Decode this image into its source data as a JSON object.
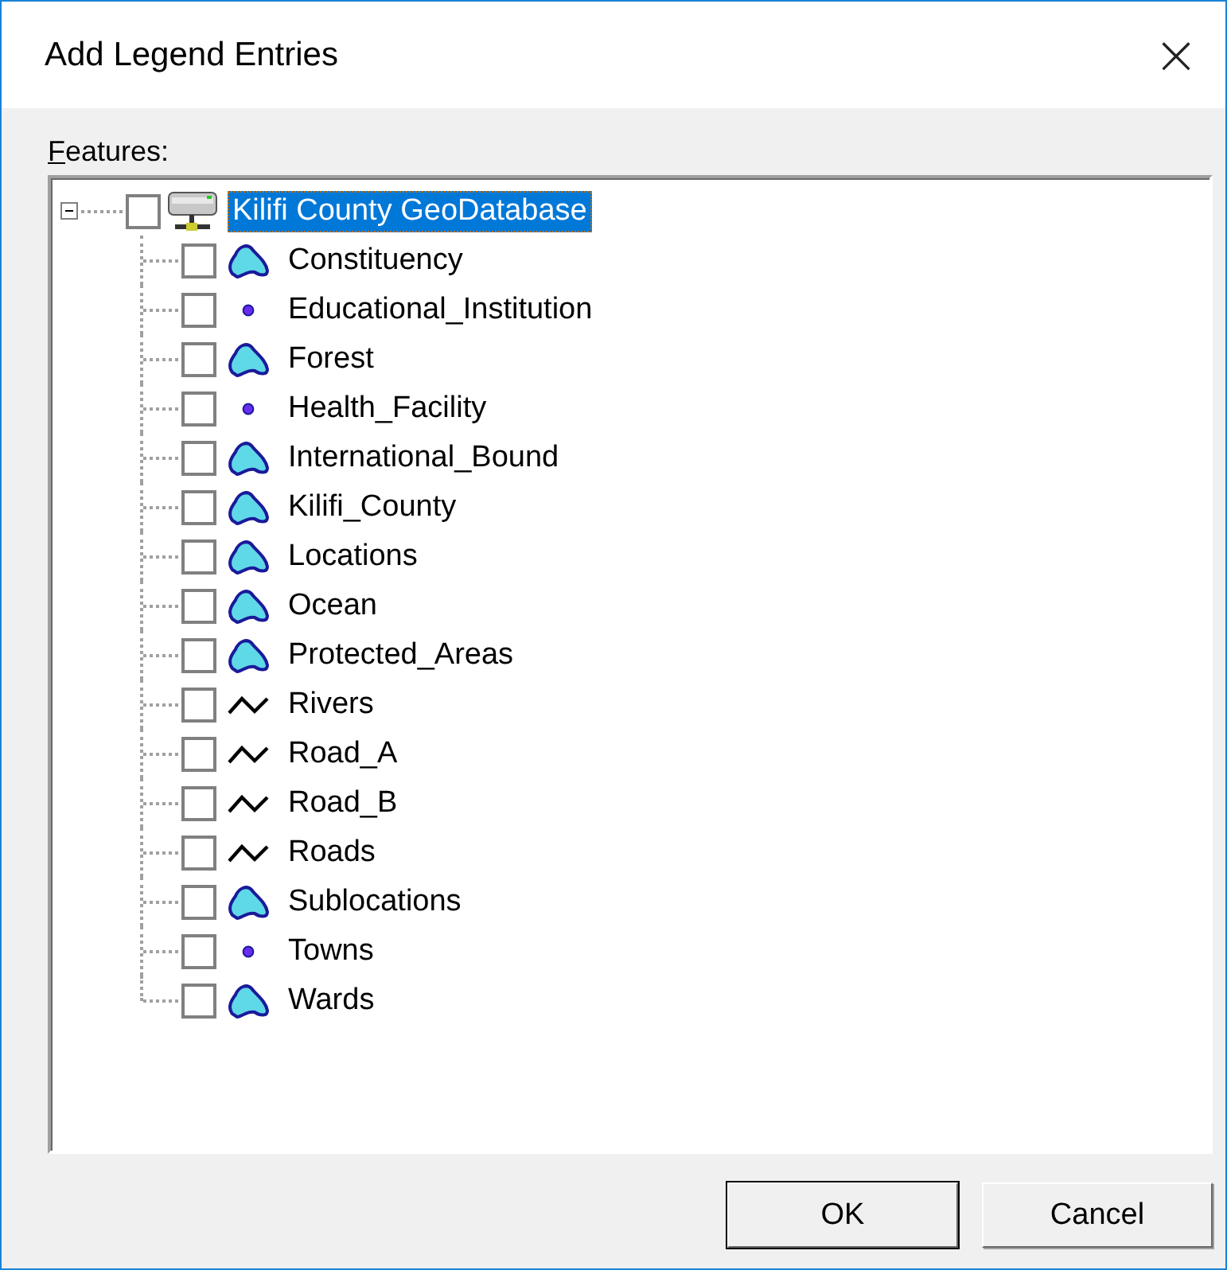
{
  "window": {
    "title": "Add Legend Entries",
    "close": "×"
  },
  "features_label": "Features:",
  "tree": {
    "label": "Kilifi County GeoDatabase",
    "expanded": true,
    "selected": true,
    "checked": false,
    "children": [
      {
        "label": "Constituency",
        "kind": "polygon",
        "checked": false
      },
      {
        "label": "Educational_Institution",
        "kind": "point",
        "checked": false
      },
      {
        "label": "Forest",
        "kind": "polygon",
        "checked": false
      },
      {
        "label": "Health_Facility",
        "kind": "point",
        "checked": false
      },
      {
        "label": "International_Bound",
        "kind": "polygon",
        "checked": false
      },
      {
        "label": "Kilifi_County",
        "kind": "polygon",
        "checked": false
      },
      {
        "label": "Locations",
        "kind": "polygon",
        "checked": false
      },
      {
        "label": "Ocean",
        "kind": "polygon",
        "checked": false
      },
      {
        "label": "Protected_Areas",
        "kind": "polygon",
        "checked": false
      },
      {
        "label": "Rivers",
        "kind": "line",
        "checked": false
      },
      {
        "label": "Road_A",
        "kind": "line",
        "checked": false
      },
      {
        "label": "Road_B",
        "kind": "line",
        "checked": false
      },
      {
        "label": "Roads",
        "kind": "line",
        "checked": false
      },
      {
        "label": "Sublocations",
        "kind": "polygon",
        "checked": false
      },
      {
        "label": "Towns",
        "kind": "point",
        "checked": false
      },
      {
        "label": "Wards",
        "kind": "polygon",
        "checked": false
      }
    ]
  },
  "buttons": [
    "OK",
    "Cancel"
  ]
}
